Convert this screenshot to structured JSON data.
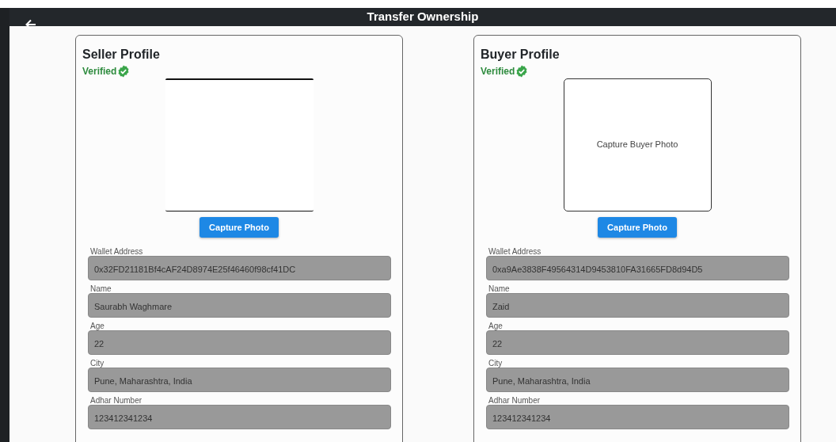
{
  "header": {
    "title": "Transfer Ownership"
  },
  "profiles": [
    {
      "title": "Seller Profile",
      "verified": true,
      "verified_label": "Verified",
      "photo": {
        "kind": "camera"
      },
      "button": "Capture Photo",
      "fields": [
        {
          "label": "Wallet Address",
          "value": "0x32FD21181Bf4cAF24D8974E25f46460f98cf41DC",
          "disabled": true
        },
        {
          "label": "Name",
          "value": "Saurabh Waghmare",
          "disabled": true
        },
        {
          "label": "Age",
          "value": "22",
          "disabled": true
        },
        {
          "label": "City",
          "value": "Pune, Maharashtra, India",
          "disabled": true
        },
        {
          "label": "Adhar Number",
          "value": "123412341234",
          "disabled": true
        }
      ]
    },
    {
      "title": "Buyer Profile",
      "verified": true,
      "verified_label": "Verified",
      "photo": {
        "kind": "placeholder",
        "text": "Capture Buyer Photo"
      },
      "button": "Capture Photo",
      "fields": [
        {
          "label": "Wallet Address",
          "value": "0xa9Ae3838F49564314D9453810FA31665FD8d94D5",
          "disabled": true
        },
        {
          "label": "Name",
          "value": "Zaid",
          "disabled": true
        },
        {
          "label": "Age",
          "value": "22",
          "disabled": true
        },
        {
          "label": "City",
          "value": "Pune, Maharashtra, India",
          "disabled": true
        },
        {
          "label": "Adhar Number",
          "value": "123412341234",
          "disabled": true
        }
      ]
    }
  ]
}
